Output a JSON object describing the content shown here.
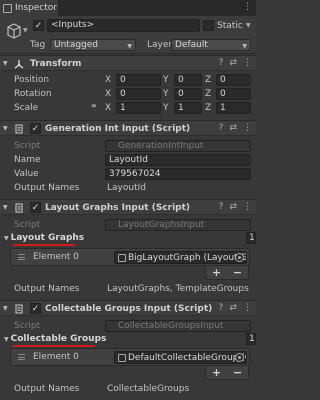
{
  "tab": {
    "title": "Inspector"
  },
  "header": {
    "object_name": "<Inputs>",
    "static_label": "Static",
    "tag_label": "Tag",
    "tag_value": "Untagged",
    "layer_label": "Layer",
    "layer_value": "Default"
  },
  "transform": {
    "title": "Transform",
    "rows": [
      {
        "label": "Position",
        "x": "0",
        "y": "0",
        "z": "0"
      },
      {
        "label": "Rotation",
        "x": "0",
        "y": "0",
        "z": "0"
      },
      {
        "label": "Scale",
        "x": "1",
        "y": "1",
        "z": "1"
      }
    ],
    "axis_x": "X",
    "axis_y": "Y",
    "axis_z": "Z"
  },
  "gen_int": {
    "title": "Generation Int Input (Script)",
    "script_label": "Script",
    "script_value": "GenerationIntInput",
    "name_label": "Name",
    "name_value": "LayoutId",
    "value_label": "Value",
    "value_value": "379567024",
    "output_label": "Output Names",
    "output_value": "LayoutId"
  },
  "layout_graphs": {
    "title": "Layout Graphs Input (Script)",
    "script_label": "Script",
    "script_value": "LayoutGraphsInput",
    "list_label": "Layout Graphs",
    "count": "1",
    "element_label": "Element 0",
    "element_value": "BigLayoutGraph (Layout Graph",
    "output_label": "Output Names",
    "output_value": "LayoutGraphs, TemplateGroups"
  },
  "collectable": {
    "title": "Collectable Groups Input (Script)",
    "script_label": "Script",
    "script_value": "CollectableGroupsInput",
    "list_label": "Collectable Groups",
    "count": "1",
    "element_label": "Element 0",
    "element_value": "DefaultCollectableGroup (Colle",
    "output_label": "Output Names",
    "output_value": "CollectableGroups"
  },
  "buttons": {
    "plus": "+",
    "minus": "−"
  },
  "colors": {
    "highlight_underline": "#d11a1a",
    "background": "#383838"
  }
}
